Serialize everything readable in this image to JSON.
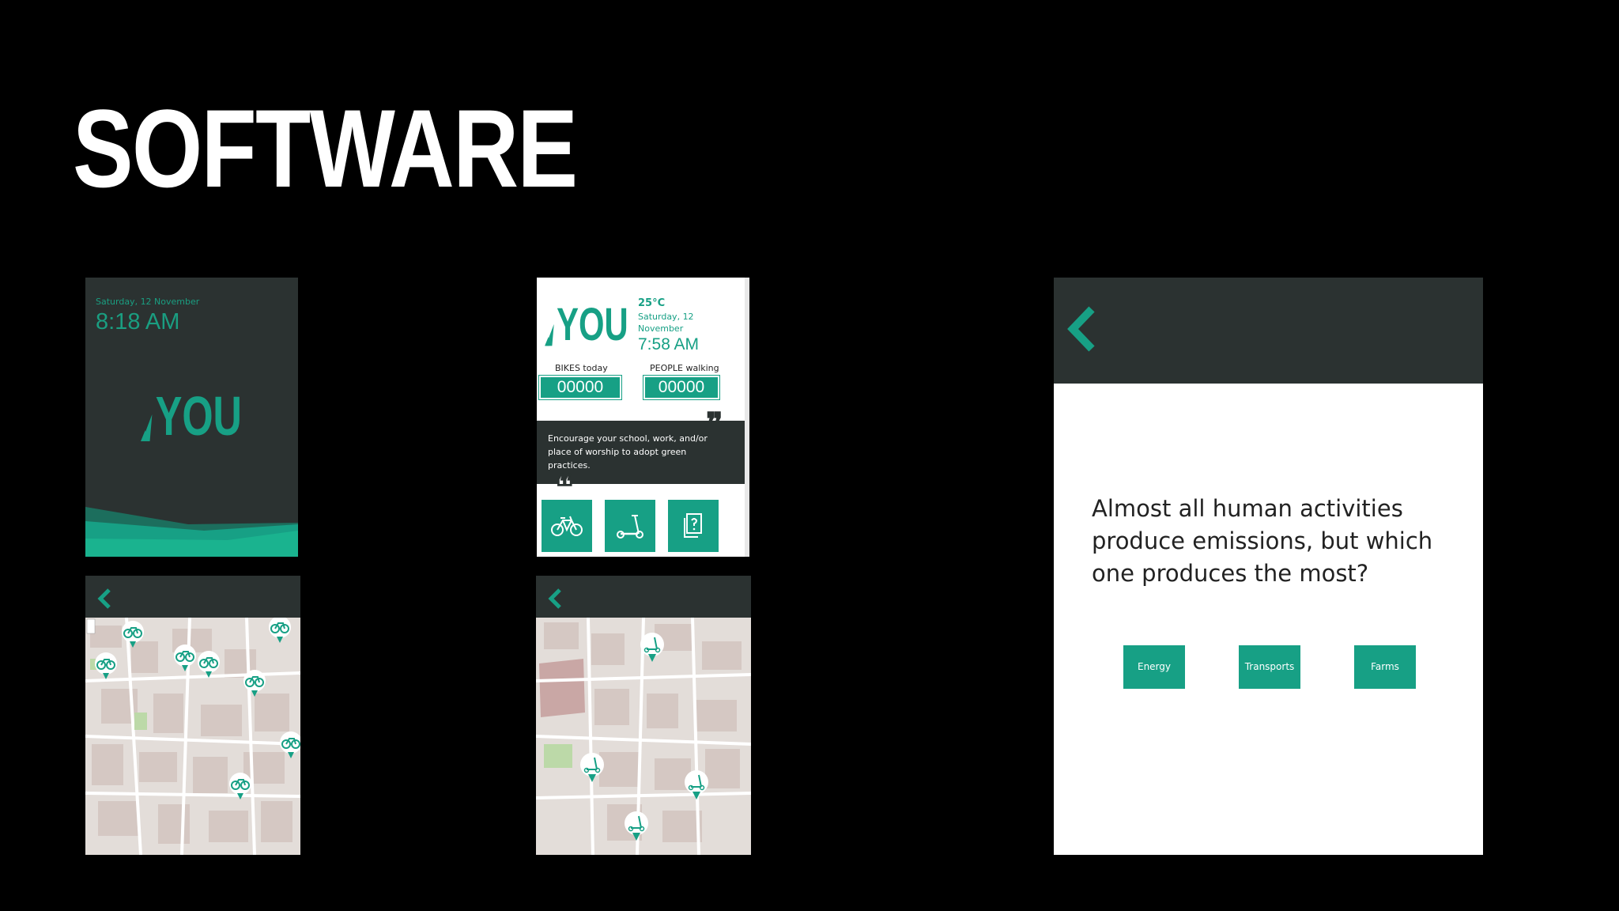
{
  "slide": {
    "title": "SOFTWARE"
  },
  "lock_screen": {
    "date": "Saturday, 12 November",
    "time": "8:18 AM",
    "logo": "YOU"
  },
  "dashboard": {
    "logo": "YOU",
    "temperature": "25°C",
    "date": "Saturday, 12 November",
    "time": "7:58 AM",
    "bikes_label": "BIKES today",
    "bikes_count": "00000",
    "people_label": "PEOPLE walking",
    "people_count": "00000",
    "tip": "Encourage your school, work, and/or place of worship to adopt green practices.",
    "tiles": [
      "bicycle-icon",
      "scooter-icon",
      "quiz-icon"
    ]
  },
  "bike_map": {
    "marker_icon": "bicycle-icon"
  },
  "scooter_map": {
    "marker_icon": "scooter-icon"
  },
  "quiz": {
    "question": "Almost all human activities produce emissions, but which one produces the most?",
    "answers": [
      "Energy",
      "Transports",
      "Farms"
    ]
  },
  "colors": {
    "accent": "#17a085",
    "dark": "#2b3231",
    "background": "#000000"
  }
}
